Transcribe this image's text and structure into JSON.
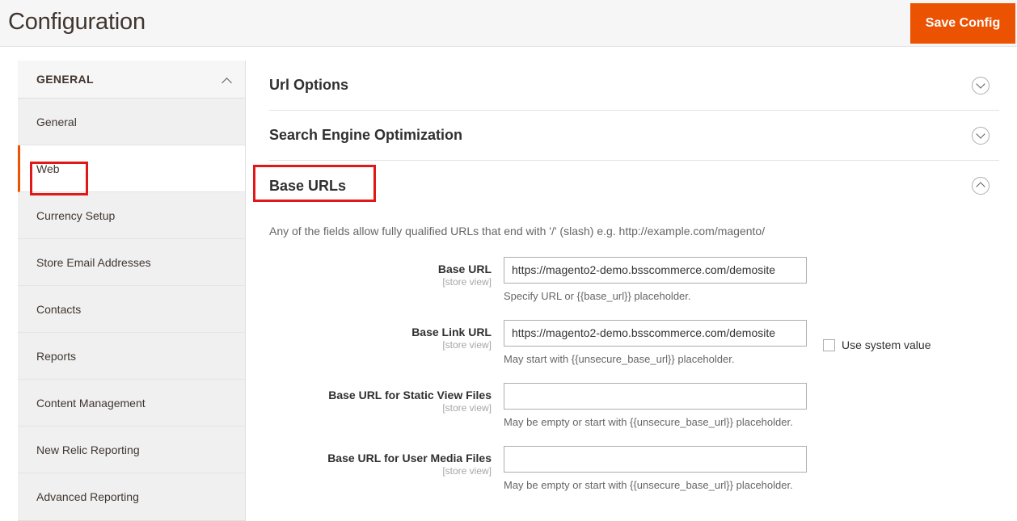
{
  "header": {
    "title": "Configuration",
    "save_label": "Save Config",
    "accent_color": "#eb5202"
  },
  "sidebar": {
    "section": {
      "label": "GENERAL",
      "chevron": "chevron-up-icon"
    },
    "items": [
      {
        "label": "General",
        "active": false
      },
      {
        "label": "Web",
        "active": true
      },
      {
        "label": "Currency Setup",
        "active": false
      },
      {
        "label": "Store Email Addresses",
        "active": false
      },
      {
        "label": "Contacts",
        "active": false
      },
      {
        "label": "Reports",
        "active": false
      },
      {
        "label": "Content Management",
        "active": false
      },
      {
        "label": "New Relic Reporting",
        "active": false
      },
      {
        "label": "Advanced Reporting",
        "active": false
      }
    ]
  },
  "content": {
    "sections": [
      {
        "heading": "Url Options",
        "state": "collapsed",
        "icon": "chevron-down-circle-icon"
      },
      {
        "heading": "Search Engine Optimization",
        "state": "collapsed",
        "icon": "chevron-down-circle-icon"
      },
      {
        "heading": "Base URLs",
        "state": "expanded",
        "icon": "chevron-up-circle-icon"
      }
    ],
    "base_urls": {
      "description": "Any of the fields allow fully qualified URLs that end with '/' (slash) e.g. http://example.com/magento/",
      "fields": [
        {
          "label": "Base URL",
          "scope": "[store view]",
          "value": "https://magento2-demo.bsscommerce.com/demosite",
          "note": "Specify URL or {{base_url}} placeholder.",
          "system_value": null
        },
        {
          "label": "Base Link URL",
          "scope": "[store view]",
          "value": "https://magento2-demo.bsscommerce.com/demosite",
          "note": "May start with {{unsecure_base_url}} placeholder.",
          "system_value": {
            "label": "Use system value",
            "checked": false
          }
        },
        {
          "label": "Base URL for Static View Files",
          "scope": "[store view]",
          "value": "",
          "note": "May be empty or start with {{unsecure_base_url}} placeholder.",
          "system_value": null
        },
        {
          "label": "Base URL for User Media Files",
          "scope": "[store view]",
          "value": "",
          "note": "May be empty or start with {{unsecure_base_url}} placeholder.",
          "system_value": null
        }
      ]
    }
  },
  "annotations": [
    {
      "name": "web-highlight",
      "color": "#e01818"
    },
    {
      "name": "base-urls-highlight",
      "color": "#e01818"
    }
  ]
}
